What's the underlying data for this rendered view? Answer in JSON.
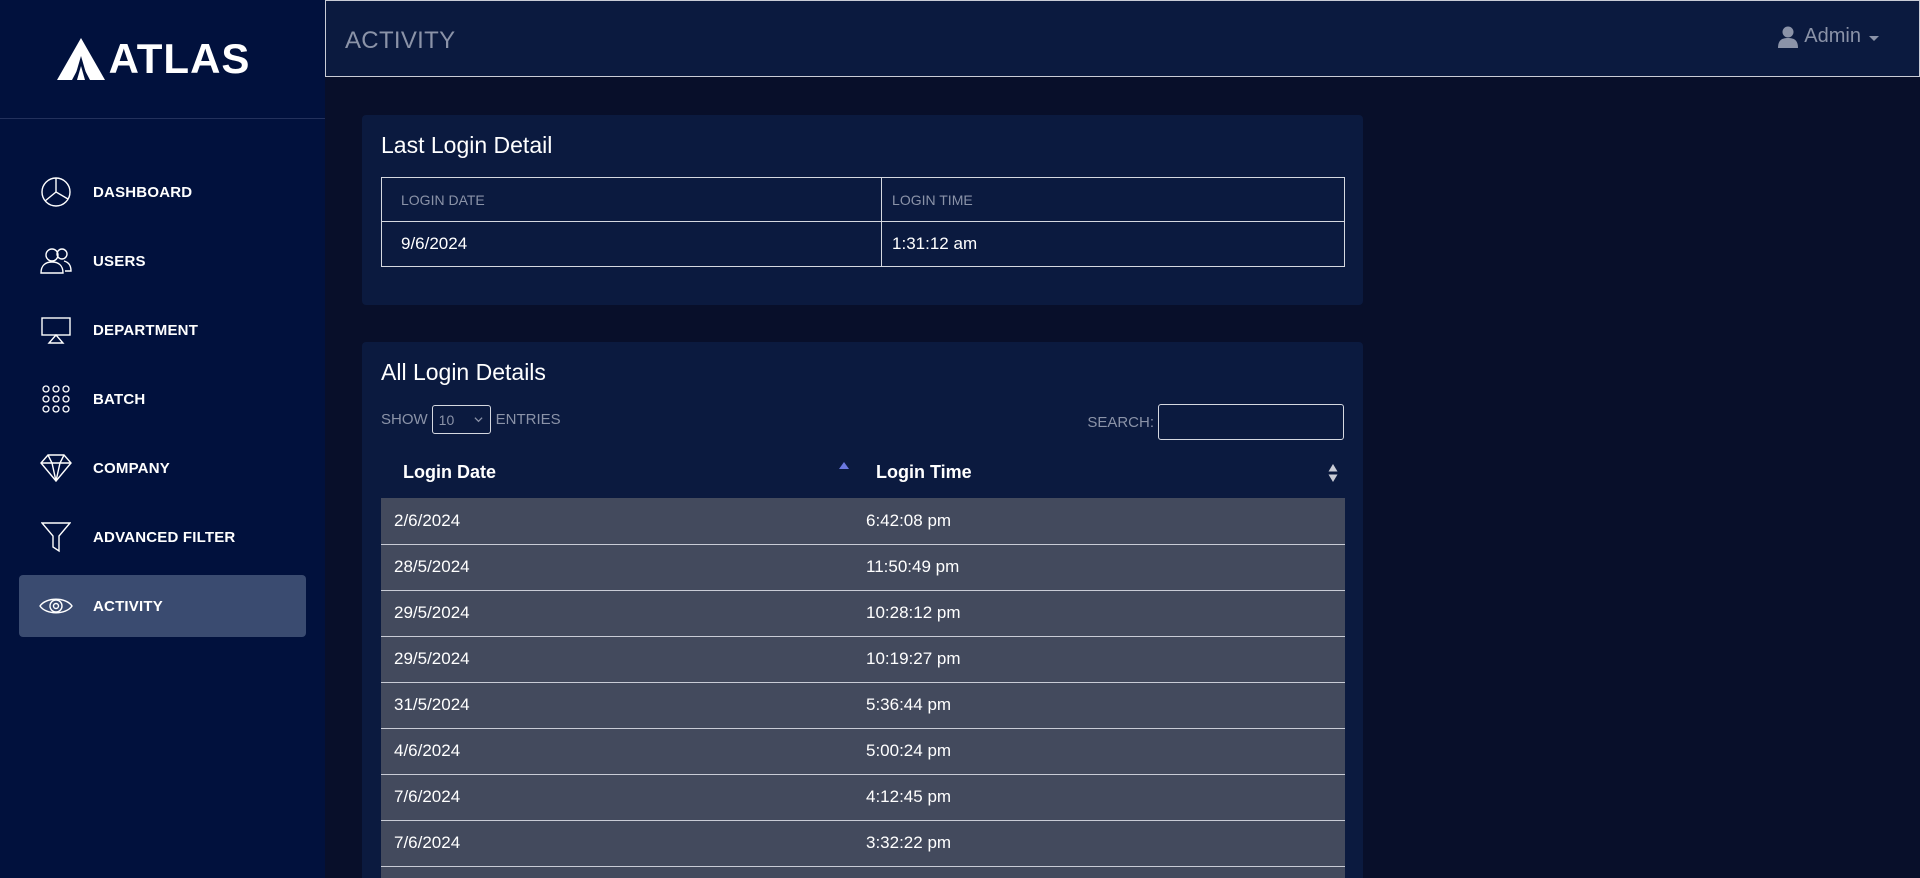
{
  "brand": {
    "name": "ATLAS"
  },
  "sidebar": {
    "items": [
      {
        "label": "DASHBOARD",
        "icon": "pie-chart-icon"
      },
      {
        "label": "USERS",
        "icon": "users-icon"
      },
      {
        "label": "DEPARTMENT",
        "icon": "presentation-icon"
      },
      {
        "label": "BATCH",
        "icon": "grid-dots-icon"
      },
      {
        "label": "COMPANY",
        "icon": "diamond-icon"
      },
      {
        "label": "ADVANCED FILTER",
        "icon": "filter-icon"
      },
      {
        "label": "ACTIVITY",
        "icon": "eye-icon",
        "active": true
      }
    ]
  },
  "header": {
    "title": "ACTIVITY",
    "user": "Admin"
  },
  "last_login": {
    "title": "Last Login Detail",
    "headers": [
      "LOGIN DATE",
      "LOGIN TIME"
    ],
    "row": {
      "date": "9/6/2024",
      "time": "1:31:12 am"
    }
  },
  "all_logins": {
    "title": "All Login Details",
    "show_label": "SHOW",
    "entries_value": "10",
    "entries_label": "ENTRIES",
    "search_label": "SEARCH:",
    "search_value": "",
    "columns": [
      "Login Date",
      "Login Time"
    ],
    "rows": [
      {
        "date": "2/6/2024",
        "time": "6:42:08 pm"
      },
      {
        "date": "28/5/2024",
        "time": "11:50:49 pm"
      },
      {
        "date": "29/5/2024",
        "time": "10:28:12 pm"
      },
      {
        "date": "29/5/2024",
        "time": "10:19:27 pm"
      },
      {
        "date": "31/5/2024",
        "time": "5:36:44 pm"
      },
      {
        "date": "4/6/2024",
        "time": "5:00:24 pm"
      },
      {
        "date": "7/6/2024",
        "time": "4:12:45 pm"
      },
      {
        "date": "7/6/2024",
        "time": "3:32:22 pm"
      },
      {
        "date": "",
        "time": ""
      }
    ]
  },
  "colors": {
    "sidebar_bg": "#01113d",
    "active_bg": "#3a4b70",
    "panel_bg": "#0b1a3f",
    "row_bg": "#434a5d",
    "sort_accent": "#6b78e0"
  }
}
